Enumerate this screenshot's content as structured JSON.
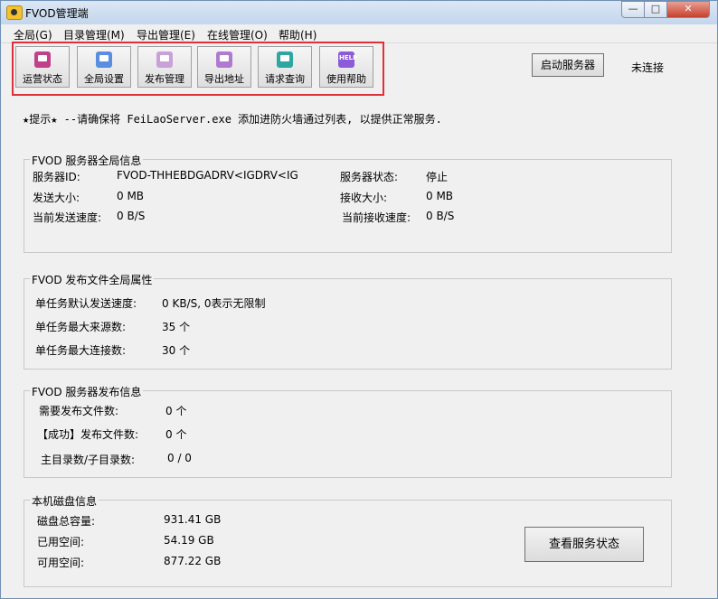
{
  "window": {
    "title": "FVOD管理端"
  },
  "menu": [
    {
      "label": "全局(G)"
    },
    {
      "label": "目录管理(M)"
    },
    {
      "label": "导出管理(E)"
    },
    {
      "label": "在线管理(O)"
    },
    {
      "label": "帮助(H)"
    }
  ],
  "toolbar": [
    {
      "label": "运营状态",
      "icon": "monitor-icon",
      "color": "#c0408a"
    },
    {
      "label": "全局设置",
      "icon": "settings-icon",
      "color": "#5a8ee0"
    },
    {
      "label": "发布管理",
      "icon": "publish-icon",
      "color": "#c9a0d8"
    },
    {
      "label": "导出地址",
      "icon": "export-icon",
      "color": "#b07ad0"
    },
    {
      "label": "请求查询",
      "icon": "query-icon",
      "color": "#2fa6a0"
    },
    {
      "label": "使用帮助",
      "icon": "help-icon",
      "icon_text": "HELP",
      "color": "#8a5cd8"
    }
  ],
  "server": {
    "start_button": "启动服务器",
    "connection_status": "未连接"
  },
  "notice": "★提示★ --请确保将 FeiLaoServer.exe  添加进防火墙通过列表, 以提供正常服务.",
  "global_info": {
    "title": "FVOD 服务器全局信息",
    "server_id_label": "服务器ID:",
    "server_id": "FVOD-THHEBDGADRV<IGDRV<IG",
    "server_status_label": "服务器状态:",
    "server_status": "停止",
    "send_size_label": "发送大小:",
    "send_size": "0 MB",
    "recv_size_label": "接收大小:",
    "recv_size": "0 MB",
    "send_speed_label": "当前发送速度:",
    "send_speed": "0 B/S",
    "recv_speed_label": "当前接收速度:",
    "recv_speed": "0 B/S"
  },
  "publish_props": {
    "title": "FVOD 发布文件全局属性",
    "speed_label": "单任务默认发送速度:",
    "speed_value": "0 KB/S, 0表示无限制",
    "sources_label": "单任务最大来源数:",
    "sources_value": "35 个",
    "conns_label": "单任务最大连接数:",
    "conns_value": "30 个"
  },
  "publish_info": {
    "title": "FVOD 服务器发布信息",
    "need_label": "需要发布文件数:",
    "need_value": "0 个",
    "success_label": "【成功】发布文件数:",
    "success_value": "0 个",
    "dirs_label": "主目录数/子目录数:",
    "dirs_value": "0 / 0"
  },
  "disk": {
    "title": "本机磁盘信息",
    "total_label": "磁盘总容量:",
    "total_value": "931.41 GB",
    "used_label": "已用空间:",
    "used_value": "54.19 GB",
    "free_label": "可用空间:",
    "free_value": "877.22 GB",
    "status_button": "查看服务状态"
  }
}
